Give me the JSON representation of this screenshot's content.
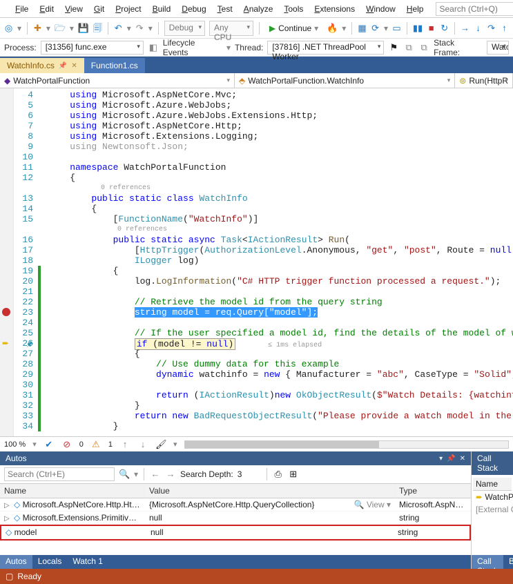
{
  "menu": {
    "items": [
      "File",
      "Edit",
      "View",
      "Git",
      "Project",
      "Build",
      "Debug",
      "Test",
      "Analyze",
      "Tools",
      "Extensions",
      "Window",
      "Help"
    ],
    "search_placeholder": "Search (Ctrl+Q)"
  },
  "toolbar": {
    "config": "Debug",
    "platform": "Any CPU",
    "continue": "Continue"
  },
  "debugbar": {
    "process_label": "Process:",
    "process_value": "[31356] func.exe",
    "lifecycle": "Lifecycle Events",
    "thread_label": "Thread:",
    "thread_value": "[37816] .NET ThreadPool Worker",
    "stackframe_label": "Stack Frame:",
    "stackframe_value": "WatchPo"
  },
  "tabs": {
    "active": "WatchInfo.cs",
    "other": "Function1.cs"
  },
  "nav": {
    "left": "WatchPortalFunction",
    "mid": "WatchPortalFunction.WatchInfo",
    "right": "Run(HttpR"
  },
  "code": {
    "first_line": 4,
    "lines": [
      {
        "n": 4,
        "t": "    using Microsoft.AspNetCore.Mvc;",
        "type": "using"
      },
      {
        "n": 5,
        "t": "    using Microsoft.Azure.WebJobs;",
        "type": "using"
      },
      {
        "n": 6,
        "t": "    using Microsoft.Azure.WebJobs.Extensions.Http;",
        "type": "using"
      },
      {
        "n": 7,
        "t": "    using Microsoft.AspNetCore.Http;",
        "type": "using"
      },
      {
        "n": 8,
        "t": "    using Microsoft.Extensions.Logging;",
        "type": "using"
      },
      {
        "n": 9,
        "t": "    using Newtonsoft.Json;",
        "type": "using-gray"
      },
      {
        "n": 10,
        "t": ""
      },
      {
        "n": 11,
        "t": "    namespace WatchPortalFunction",
        "type": "ns"
      },
      {
        "n": 12,
        "t": "    {"
      },
      {
        "n": null,
        "t": "            0 references",
        "type": "codelens"
      },
      {
        "n": 13,
        "t": "        public static class WatchInfo",
        "type": "cls"
      },
      {
        "n": 14,
        "t": "        {"
      },
      {
        "n": 15,
        "t": "            [FunctionName(\"WatchInfo\")]",
        "type": "attr"
      },
      {
        "n": null,
        "t": "                0 references",
        "type": "codelens"
      },
      {
        "n": 16,
        "t": "            public static async Task<IActionResult> Run(",
        "type": "sig"
      },
      {
        "n": 17,
        "t": "                [HttpTrigger(AuthorizationLevel.Anonymous, \"get\", \"post\", Route = null)] HttpReque",
        "type": "attr2"
      },
      {
        "n": 18,
        "t": "                ILogger log)",
        "type": "param"
      },
      {
        "n": 19,
        "t": "            {"
      },
      {
        "n": 20,
        "t": "                log.LogInformation(\"C# HTTP trigger function processed a request.\");",
        "type": "loginfo"
      },
      {
        "n": 21,
        "t": ""
      },
      {
        "n": 22,
        "t": "                // Retrieve the model id from the query string",
        "type": "com"
      },
      {
        "n": 23,
        "t": "                string model = req.Query[\"model\"];",
        "type": "hl"
      },
      {
        "n": 24,
        "t": ""
      },
      {
        "n": 25,
        "t": "                // If the user specified a model id, find the details of the model of watch",
        "type": "com"
      },
      {
        "n": 26,
        "t": "                if (model != null)      ≤ 1ms elapsed",
        "type": "cur"
      },
      {
        "n": 27,
        "t": "                {"
      },
      {
        "n": 28,
        "t": "                    // Use dummy data for this example",
        "type": "com"
      },
      {
        "n": 29,
        "t": "                    dynamic watchinfo = new { Manufacturer = \"abc\", CaseType = \"Solid\", Bezel = \"T",
        "type": "dyn"
      },
      {
        "n": 30,
        "t": ""
      },
      {
        "n": 31,
        "t": "                    return (IActionResult)new OkObjectResult($\"Watch Details: {watchinfo.Manufactur",
        "type": "ret1"
      },
      {
        "n": 32,
        "t": "                }"
      },
      {
        "n": 33,
        "t": "                return new BadRequestObjectResult(\"Please provide a watch model in the query strin",
        "type": "ret2"
      },
      {
        "n": 34,
        "t": "            }"
      }
    ],
    "breakpoint_line": 23,
    "current_line": 26
  },
  "editor_status": {
    "zoom": "100 %",
    "errors": "0",
    "warnings": "1"
  },
  "autos": {
    "title": "Autos",
    "search_placeholder": "Search (Ctrl+E)",
    "depth_label": "Search Depth:",
    "depth_value": "3",
    "columns": [
      "Name",
      "Value",
      "Type"
    ],
    "rows": [
      {
        "name": "Microsoft.AspNetCore.Http.Http…",
        "value": "{Microsoft.AspNetCore.Http.QueryCollection}",
        "type": "Microsoft.AspNet…",
        "expandable": true,
        "view": true
      },
      {
        "name": "Microsoft.Extensions.Primitives.S…",
        "value": "null",
        "type": "string",
        "expandable": true
      },
      {
        "name": "model",
        "value": "null",
        "type": "string",
        "highlight": true
      }
    ],
    "bottom_tabs": [
      "Autos",
      "Locals",
      "Watch 1"
    ]
  },
  "callstack": {
    "title": "Call Stack",
    "col": "Name",
    "rows": [
      "WatchPortalFu",
      "[External Code"
    ],
    "bottom_tabs": [
      "Call Stack",
      "Break"
    ]
  },
  "status": "Ready"
}
